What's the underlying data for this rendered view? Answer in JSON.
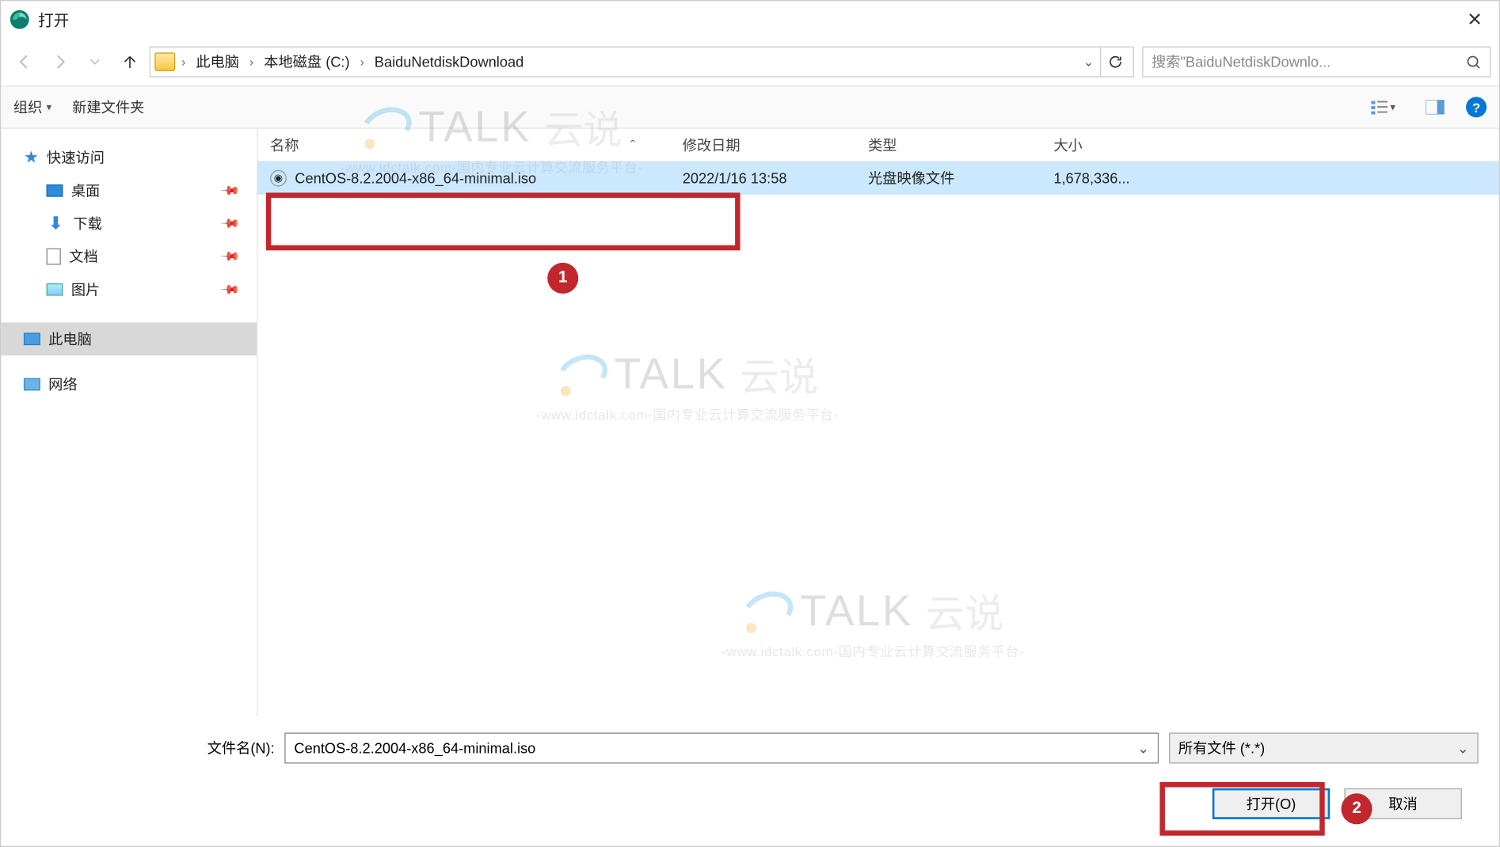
{
  "titlebar": {
    "title": "打开"
  },
  "breadcrumb": {
    "items": [
      "此电脑",
      "本地磁盘 (C:)",
      "BaiduNetdiskDownload"
    ]
  },
  "search": {
    "placeholder": "搜索\"BaiduNetdiskDownlo..."
  },
  "toolbar": {
    "organize": "组织",
    "new_folder": "新建文件夹"
  },
  "sidebar": {
    "quick_access": "快速访问",
    "desktop": "桌面",
    "downloads": "下载",
    "documents": "文档",
    "pictures": "图片",
    "this_pc": "此电脑",
    "network": "网络"
  },
  "columns": {
    "name": "名称",
    "date": "修改日期",
    "type": "类型",
    "size": "大小"
  },
  "files": [
    {
      "name": "CentOS-8.2.2004-x86_64-minimal.iso",
      "date": "2022/1/16 13:58",
      "type": "光盘映像文件",
      "size": "1,678,336..."
    }
  ],
  "filename": {
    "label": "文件名(N):",
    "value": "CentOS-8.2.2004-x86_64-minimal.iso"
  },
  "filetype": {
    "value": "所有文件 (*.*)"
  },
  "buttons": {
    "open": "打开(O)",
    "cancel": "取消"
  },
  "watermark": {
    "brand": "TALK",
    "brand_cn": "云说",
    "sub": "-www.idctalk.com-国内专业云计算交流服务平台-"
  },
  "annotations": {
    "badge1": "1",
    "badge2": "2"
  }
}
